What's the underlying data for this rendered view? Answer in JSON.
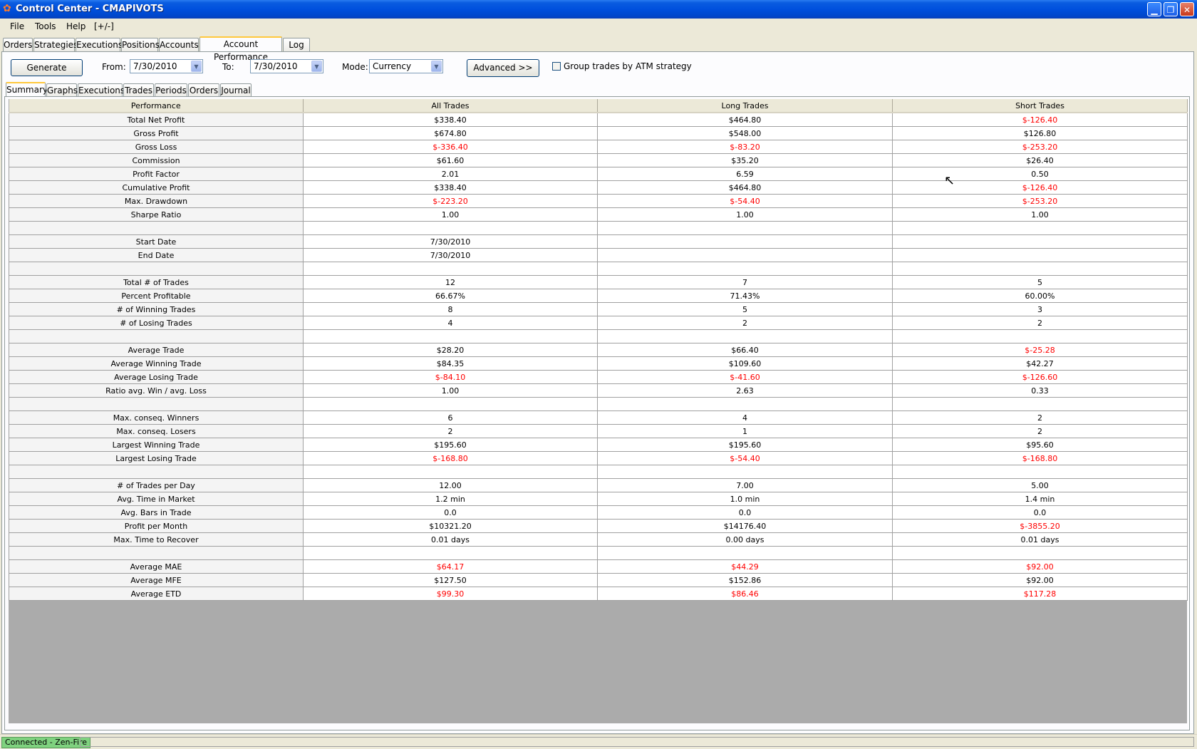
{
  "window": {
    "title": "Control Center - CMAPIVOTS",
    "app_icon": "ninjatrader-icon",
    "minimize": "▁",
    "maximize": "❐",
    "close": "✕"
  },
  "menu": [
    "File",
    "Tools",
    "Help",
    "[+/-]"
  ],
  "main_tabs": [
    "Orders",
    "Strategies",
    "Executions",
    "Positions",
    "Accounts",
    "Account Performance",
    "Log"
  ],
  "main_tab_active": "Account Performance",
  "toolbar": {
    "generate_label": "Generate",
    "from_label": "From:",
    "from_value": "7/30/2010",
    "to_label": "To:",
    "to_value": "7/30/2010",
    "mode_label": "Mode:",
    "mode_value": "Currency",
    "advanced_label": "Advanced >>",
    "group_trades_label": "Group trades by ATM strategy",
    "group_trades_checked": false
  },
  "sub_tabs": [
    "Summary",
    "Graphs",
    "Executions",
    "Trades",
    "Periods",
    "Orders",
    "Journal"
  ],
  "sub_tab_active": "Summary",
  "table": {
    "headers": [
      "Performance",
      "All Trades",
      "Long Trades",
      "Short Trades"
    ],
    "rows": [
      [
        "Total Net Profit",
        "$338.40",
        "$464.80",
        "$-126.40"
      ],
      [
        "Gross Profit",
        "$674.80",
        "$548.00",
        "$126.80"
      ],
      [
        "Gross Loss",
        "$-336.40",
        "$-83.20",
        "$-253.20"
      ],
      [
        "Commission",
        "$61.60",
        "$35.20",
        "$26.40"
      ],
      [
        "Profit Factor",
        "2.01",
        "6.59",
        "0.50"
      ],
      [
        "Cumulative Profit",
        "$338.40",
        "$464.80",
        "$-126.40"
      ],
      [
        "Max. Drawdown",
        "$-223.20",
        "$-54.40",
        "$-253.20"
      ],
      [
        "Sharpe Ratio",
        "1.00",
        "1.00",
        "1.00"
      ],
      [
        "",
        "",
        "",
        ""
      ],
      [
        "Start Date",
        "7/30/2010",
        "",
        ""
      ],
      [
        "End Date",
        "7/30/2010",
        "",
        ""
      ],
      [
        "",
        "",
        "",
        ""
      ],
      [
        "Total # of Trades",
        "12",
        "7",
        "5"
      ],
      [
        "Percent Profitable",
        "66.67%",
        "71.43%",
        "60.00%"
      ],
      [
        "# of Winning Trades",
        "8",
        "5",
        "3"
      ],
      [
        "# of Losing Trades",
        "4",
        "2",
        "2"
      ],
      [
        "",
        "",
        "",
        ""
      ],
      [
        "Average Trade",
        "$28.20",
        "$66.40",
        "$-25.28"
      ],
      [
        "Average Winning Trade",
        "$84.35",
        "$109.60",
        "$42.27"
      ],
      [
        "Average Losing Trade",
        "$-84.10",
        "$-41.60",
        "$-126.60"
      ],
      [
        "Ratio avg. Win / avg. Loss",
        "1.00",
        "2.63",
        "0.33"
      ],
      [
        "",
        "",
        "",
        ""
      ],
      [
        "Max. conseq. Winners",
        "6",
        "4",
        "2"
      ],
      [
        "Max. conseq. Losers",
        "2",
        "1",
        "2"
      ],
      [
        "Largest Winning Trade",
        "$195.60",
        "$195.60",
        "$95.60"
      ],
      [
        "Largest Losing Trade",
        "$-168.80",
        "$-54.40",
        "$-168.80"
      ],
      [
        "",
        "",
        "",
        ""
      ],
      [
        "# of Trades per Day",
        "12.00",
        "7.00",
        "5.00"
      ],
      [
        "Avg. Time in Market",
        "1.2 min",
        "1.0 min",
        "1.4 min"
      ],
      [
        "Avg. Bars in Trade",
        "0.0",
        "0.0",
        "0.0"
      ],
      [
        "Profit per Month",
        "$10321.20",
        "$14176.40",
        "$-3855.20"
      ],
      [
        "Max. Time to Recover",
        "0.01 days",
        "0.00 days",
        "0.01 days"
      ],
      [
        "",
        "",
        "",
        ""
      ],
      [
        "Average MAE",
        "$64.17",
        "$44.29",
        "$92.00"
      ],
      [
        "Average MFE",
        "$127.50",
        "$152.86",
        "$92.00"
      ],
      [
        "Average ETD",
        "$99.30",
        "$86.46",
        "$117.28"
      ]
    ],
    "red_rows": [
      "Average MAE",
      "Average ETD"
    ],
    "negative_color": "#FF0000"
  },
  "status": {
    "connection": "Connected - Zen-Fire",
    "connection_color": "#7FD27F"
  }
}
